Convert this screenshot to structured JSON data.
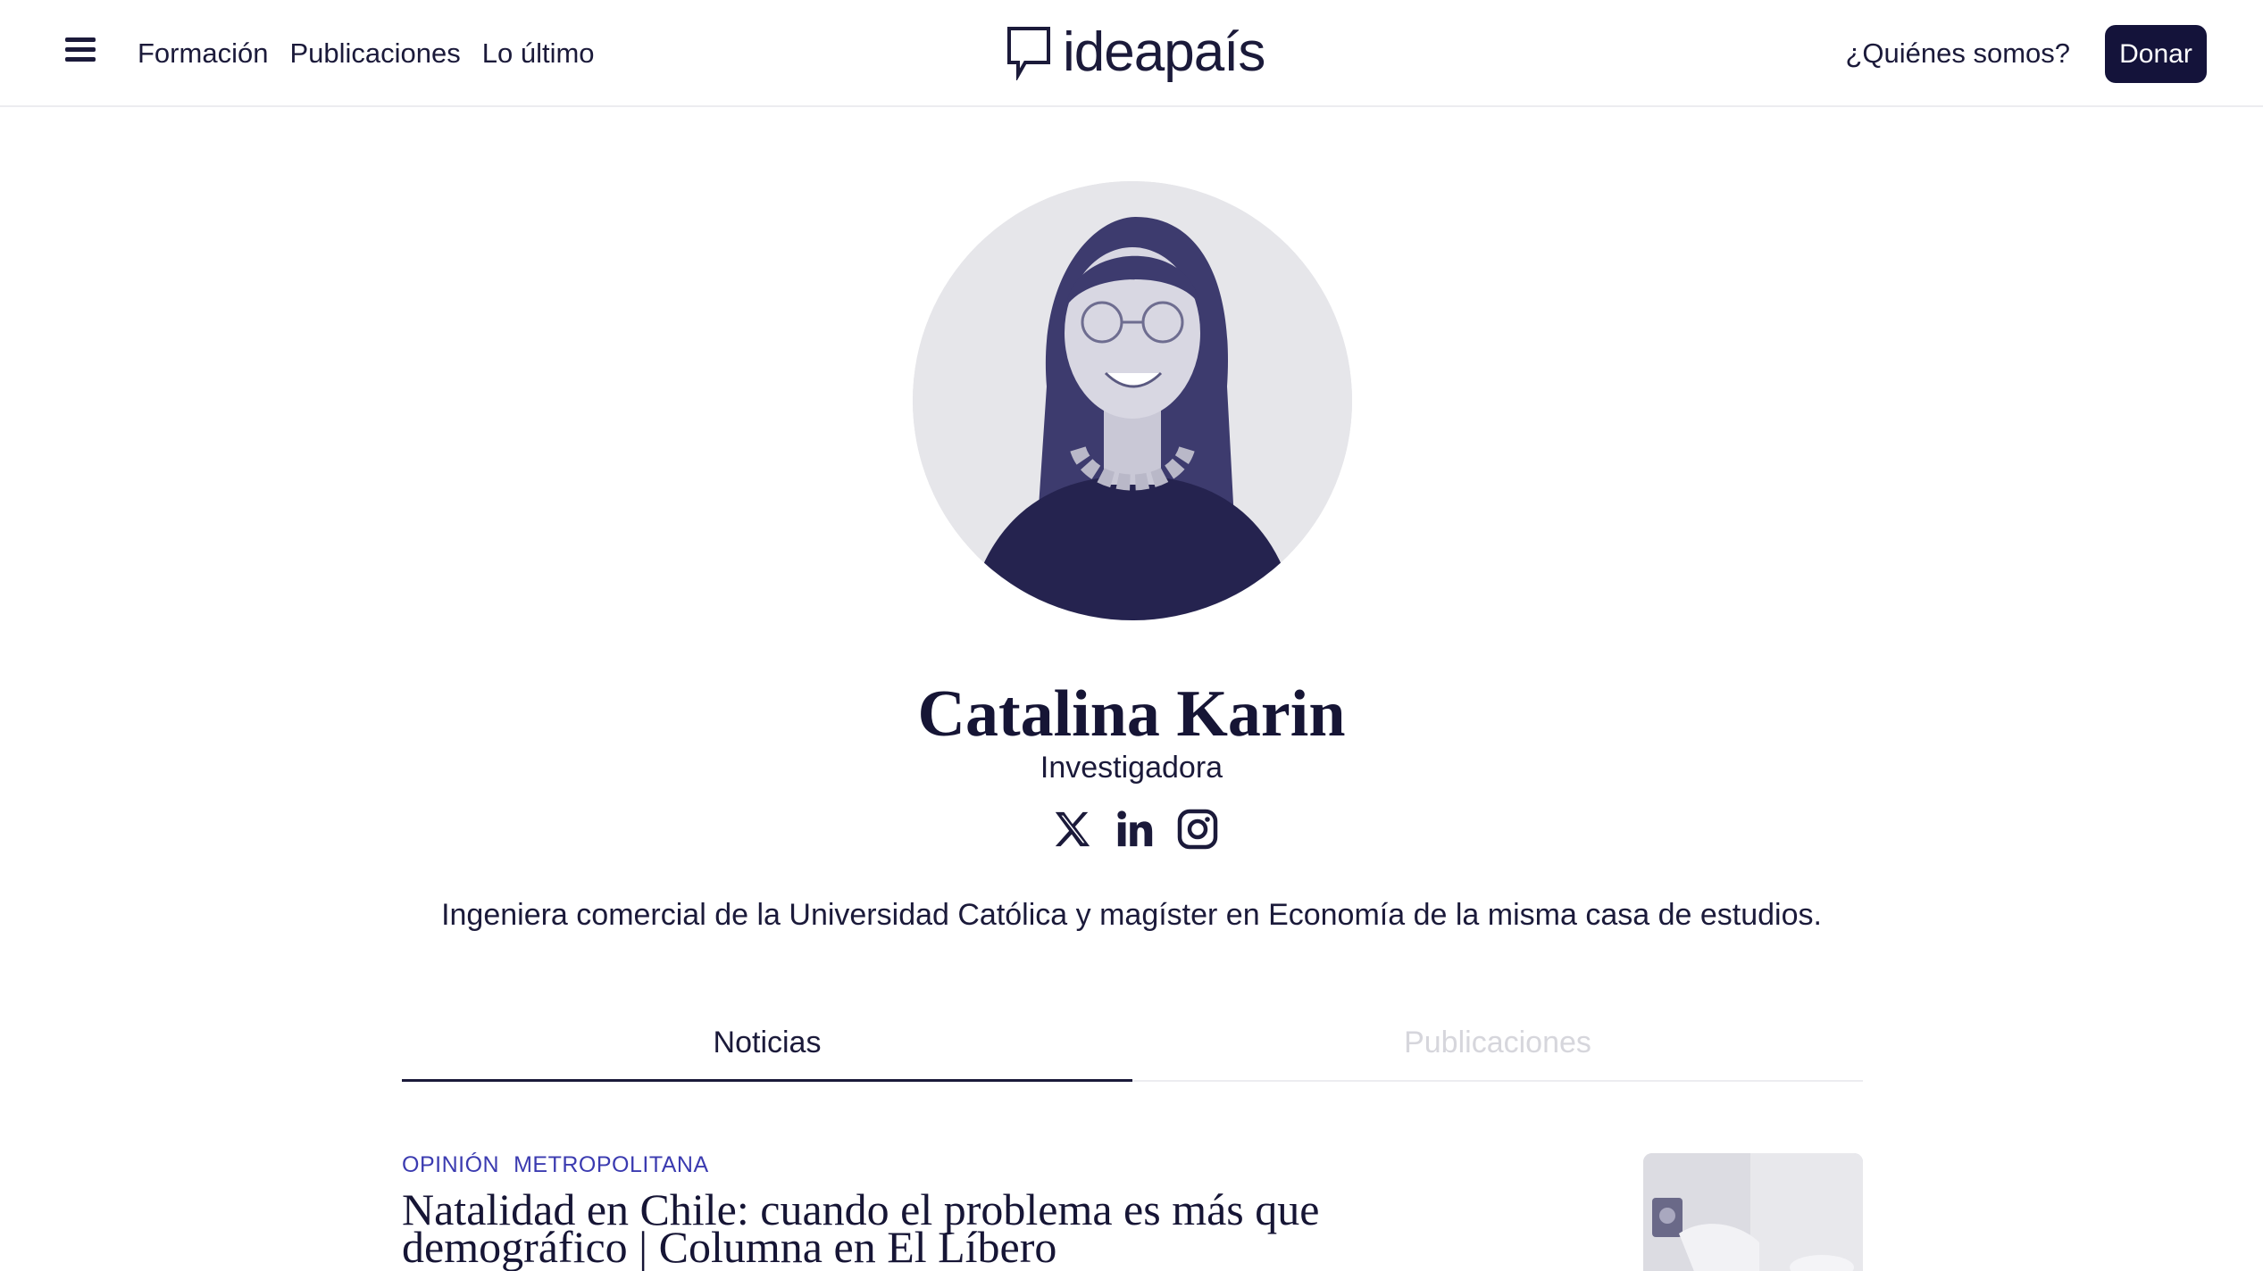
{
  "header": {
    "nav": [
      "Formación",
      "Publicaciones",
      "Lo último"
    ],
    "logo": "ideapaís",
    "about_link": "¿Quiénes somos?",
    "donate_label": "Donar"
  },
  "profile": {
    "name": "Catalina Karin",
    "role": "Investigadora",
    "social_icons": [
      "x-icon",
      "linkedin-icon",
      "instagram-icon"
    ],
    "bio": "Ingeniera comercial de la Universidad Católica y magíster en Economía de la misma casa de estudios."
  },
  "tabs": [
    {
      "label": "Noticias",
      "active": true
    },
    {
      "label": "Publicaciones",
      "active": false
    }
  ],
  "article": {
    "tags": [
      "OPINIÓN",
      "METROPOLITANA"
    ],
    "title": "Natalidad en Chile: cuando el problema es más que demográfico | Columna en El Líbero"
  },
  "colors": {
    "brand_dark": "#14133a",
    "tag_blue": "#3b3bb0",
    "inactive_tab": "#d6d6dc"
  }
}
